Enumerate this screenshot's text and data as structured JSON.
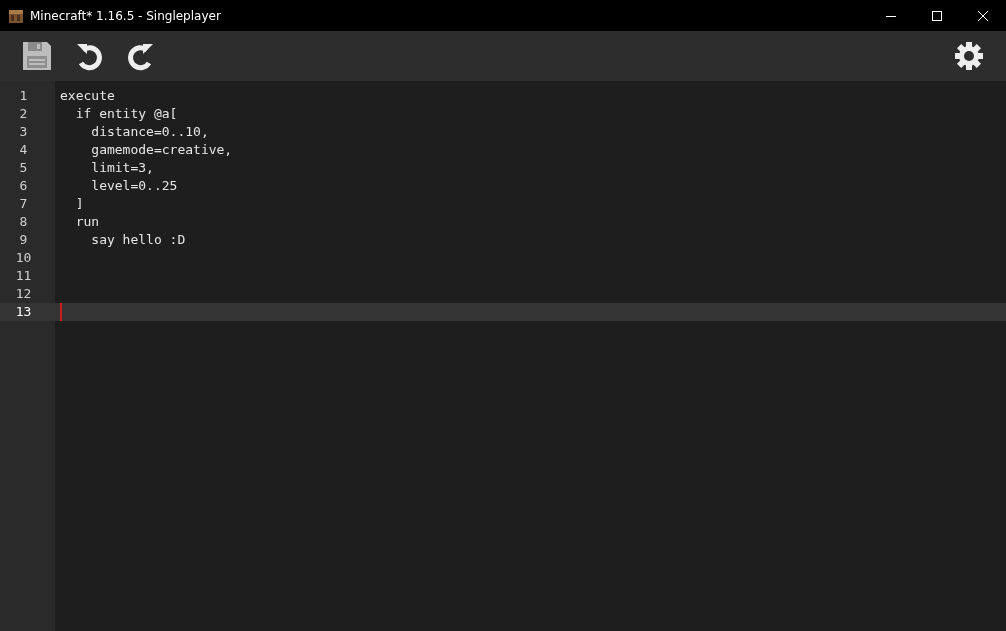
{
  "window": {
    "title": "Minecraft* 1.16.5 - Singleplayer"
  },
  "toolbar": {
    "left": [
      {
        "kind": "save"
      },
      {
        "kind": "undo"
      },
      {
        "kind": "redo"
      }
    ],
    "right": [
      {
        "kind": "settings"
      }
    ]
  },
  "editor": {
    "lines": [
      {
        "number": "1",
        "text": "execute",
        "current": false
      },
      {
        "number": "2",
        "text": "  if entity @a[",
        "current": false
      },
      {
        "number": "3",
        "text": "    distance=0..10,",
        "current": false
      },
      {
        "number": "4",
        "text": "    gamemode=creative,",
        "current": false
      },
      {
        "number": "5",
        "text": "    limit=3,",
        "current": false
      },
      {
        "number": "6",
        "text": "    level=0..25",
        "current": false
      },
      {
        "number": "7",
        "text": "  ]",
        "current": false
      },
      {
        "number": "8",
        "text": "  run",
        "current": false
      },
      {
        "number": "9",
        "text": "    say hello :D",
        "current": false
      },
      {
        "number": "10",
        "current": false
      },
      {
        "number": "11",
        "current": false
      },
      {
        "number": "12",
        "current": false
      },
      {
        "number": "13",
        "current": true
      }
    ]
  }
}
